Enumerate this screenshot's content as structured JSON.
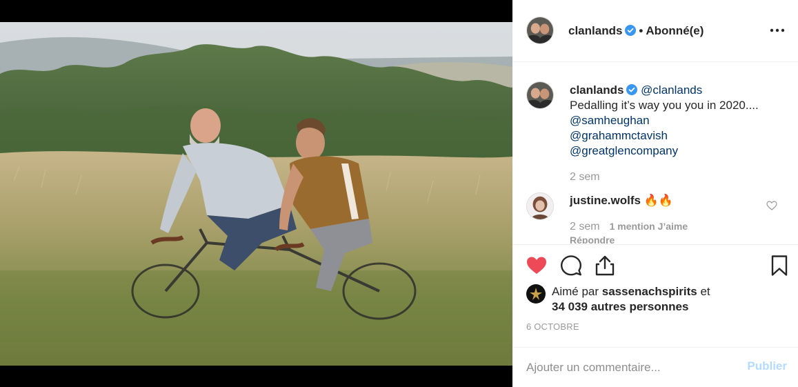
{
  "post": {
    "username": "clanlands",
    "separator": "•",
    "follow_status": "Abonné(e)",
    "verified_icon": "verified-badge-icon",
    "more_icon": "more-options-icon"
  },
  "caption": {
    "username": "clanlands",
    "handle": "@clanlands",
    "text": "Pedalling it’s way you you in 2020....",
    "mentions": [
      "@samheughan",
      "@grahammctavish",
      "@greatglencompany"
    ],
    "time": "2 sem"
  },
  "comment": {
    "username": "justine.wolfs",
    "text": "🔥🔥",
    "time": "2 sem",
    "likes": "1 mention J’aime",
    "reply": "Répondre"
  },
  "actions": {
    "like_icon": "heart-filled-icon",
    "comment_icon": "comment-bubble-icon",
    "share_icon": "share-icon",
    "save_icon": "bookmark-icon"
  },
  "likes": {
    "prefix": "Aimé par",
    "liked_by": "sassenachspirits",
    "conjunction": "et",
    "others": "34 039 autres personnes"
  },
  "date": "6 OCTOBRE",
  "add_comment": {
    "placeholder": "Ajouter un commentaire...",
    "post_label": "Publier"
  },
  "colors": {
    "heart": "#ed4956",
    "verified": "#3897f0",
    "link": "#003569",
    "muted": "#999999",
    "publish_disabled": "#b3dbff"
  }
}
